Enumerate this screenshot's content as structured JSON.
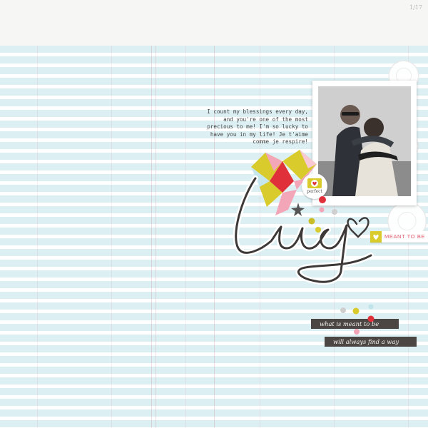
{
  "page": {
    "page_number": "1/17",
    "accent_colors": {
      "ledger_blue": "#dceff3",
      "yellow": "#d9cb2b",
      "pink": "#f2a6b8",
      "red": "#e0303a",
      "charcoal": "#4b4644",
      "tag_text": "#e25a6a"
    }
  },
  "journaling": {
    "text": "I count my blessings every day, and you're one of the most precious to me! I'm so lucky to have you in my life! Je t'aime comme je respire!"
  },
  "title_word": {
    "text": "lucky"
  },
  "sticker": {
    "label": "perfect",
    "icon": "camera-heart-icon"
  },
  "tag": {
    "text": "MEANT TO BE",
    "icon": "heart-icon"
  },
  "strips": [
    {
      "text": "what is meant to be"
    },
    {
      "text": "will always find a way"
    }
  ],
  "photo": {
    "icon": "couple-photo"
  }
}
